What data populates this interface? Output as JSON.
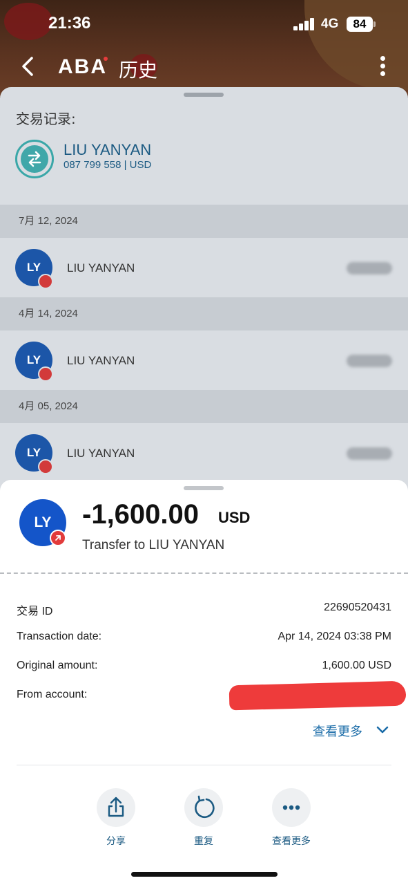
{
  "status_bar": {
    "time": "21:36",
    "network": "4G",
    "battery": "84"
  },
  "nav": {
    "logo": "ABA",
    "title": "历史"
  },
  "history": {
    "label": "交易记录:",
    "contact": {
      "name": "LIU YANYAN",
      "account": "087 799 558 | USD"
    },
    "groups": [
      {
        "date": "7月 12, 2024",
        "avatar": "LY",
        "name": "LIU YANYAN"
      },
      {
        "date": "4月 14, 2024",
        "avatar": "LY",
        "name": "LIU YANYAN"
      },
      {
        "date": "4月 05, 2024",
        "avatar": "LY",
        "name": "LIU YANYAN"
      }
    ]
  },
  "detail": {
    "avatar": "LY",
    "amount": "-1,600.00",
    "currency": "USD",
    "description": "Transfer to LIU YANYAN",
    "rows": [
      {
        "label": "交易 ID",
        "value": "22690520431"
      },
      {
        "label": "Transaction date:",
        "value": "Apr 14, 2024 03:38 PM"
      },
      {
        "label": "Original amount:",
        "value": "1,600.00 USD"
      },
      {
        "label": "From account:",
        "value": ""
      }
    ],
    "see_more": "查看更多",
    "actions": [
      {
        "label": "分享",
        "icon": "share-icon"
      },
      {
        "label": "重复",
        "icon": "repeat-icon"
      },
      {
        "label": "查看更多",
        "icon": "more-horizontal-icon"
      }
    ]
  },
  "colors": {
    "accent": "#1b6ca8",
    "avatar": "#1455c9",
    "debit_badge": "#e23b3b",
    "redaction": "#ee3b3b"
  }
}
